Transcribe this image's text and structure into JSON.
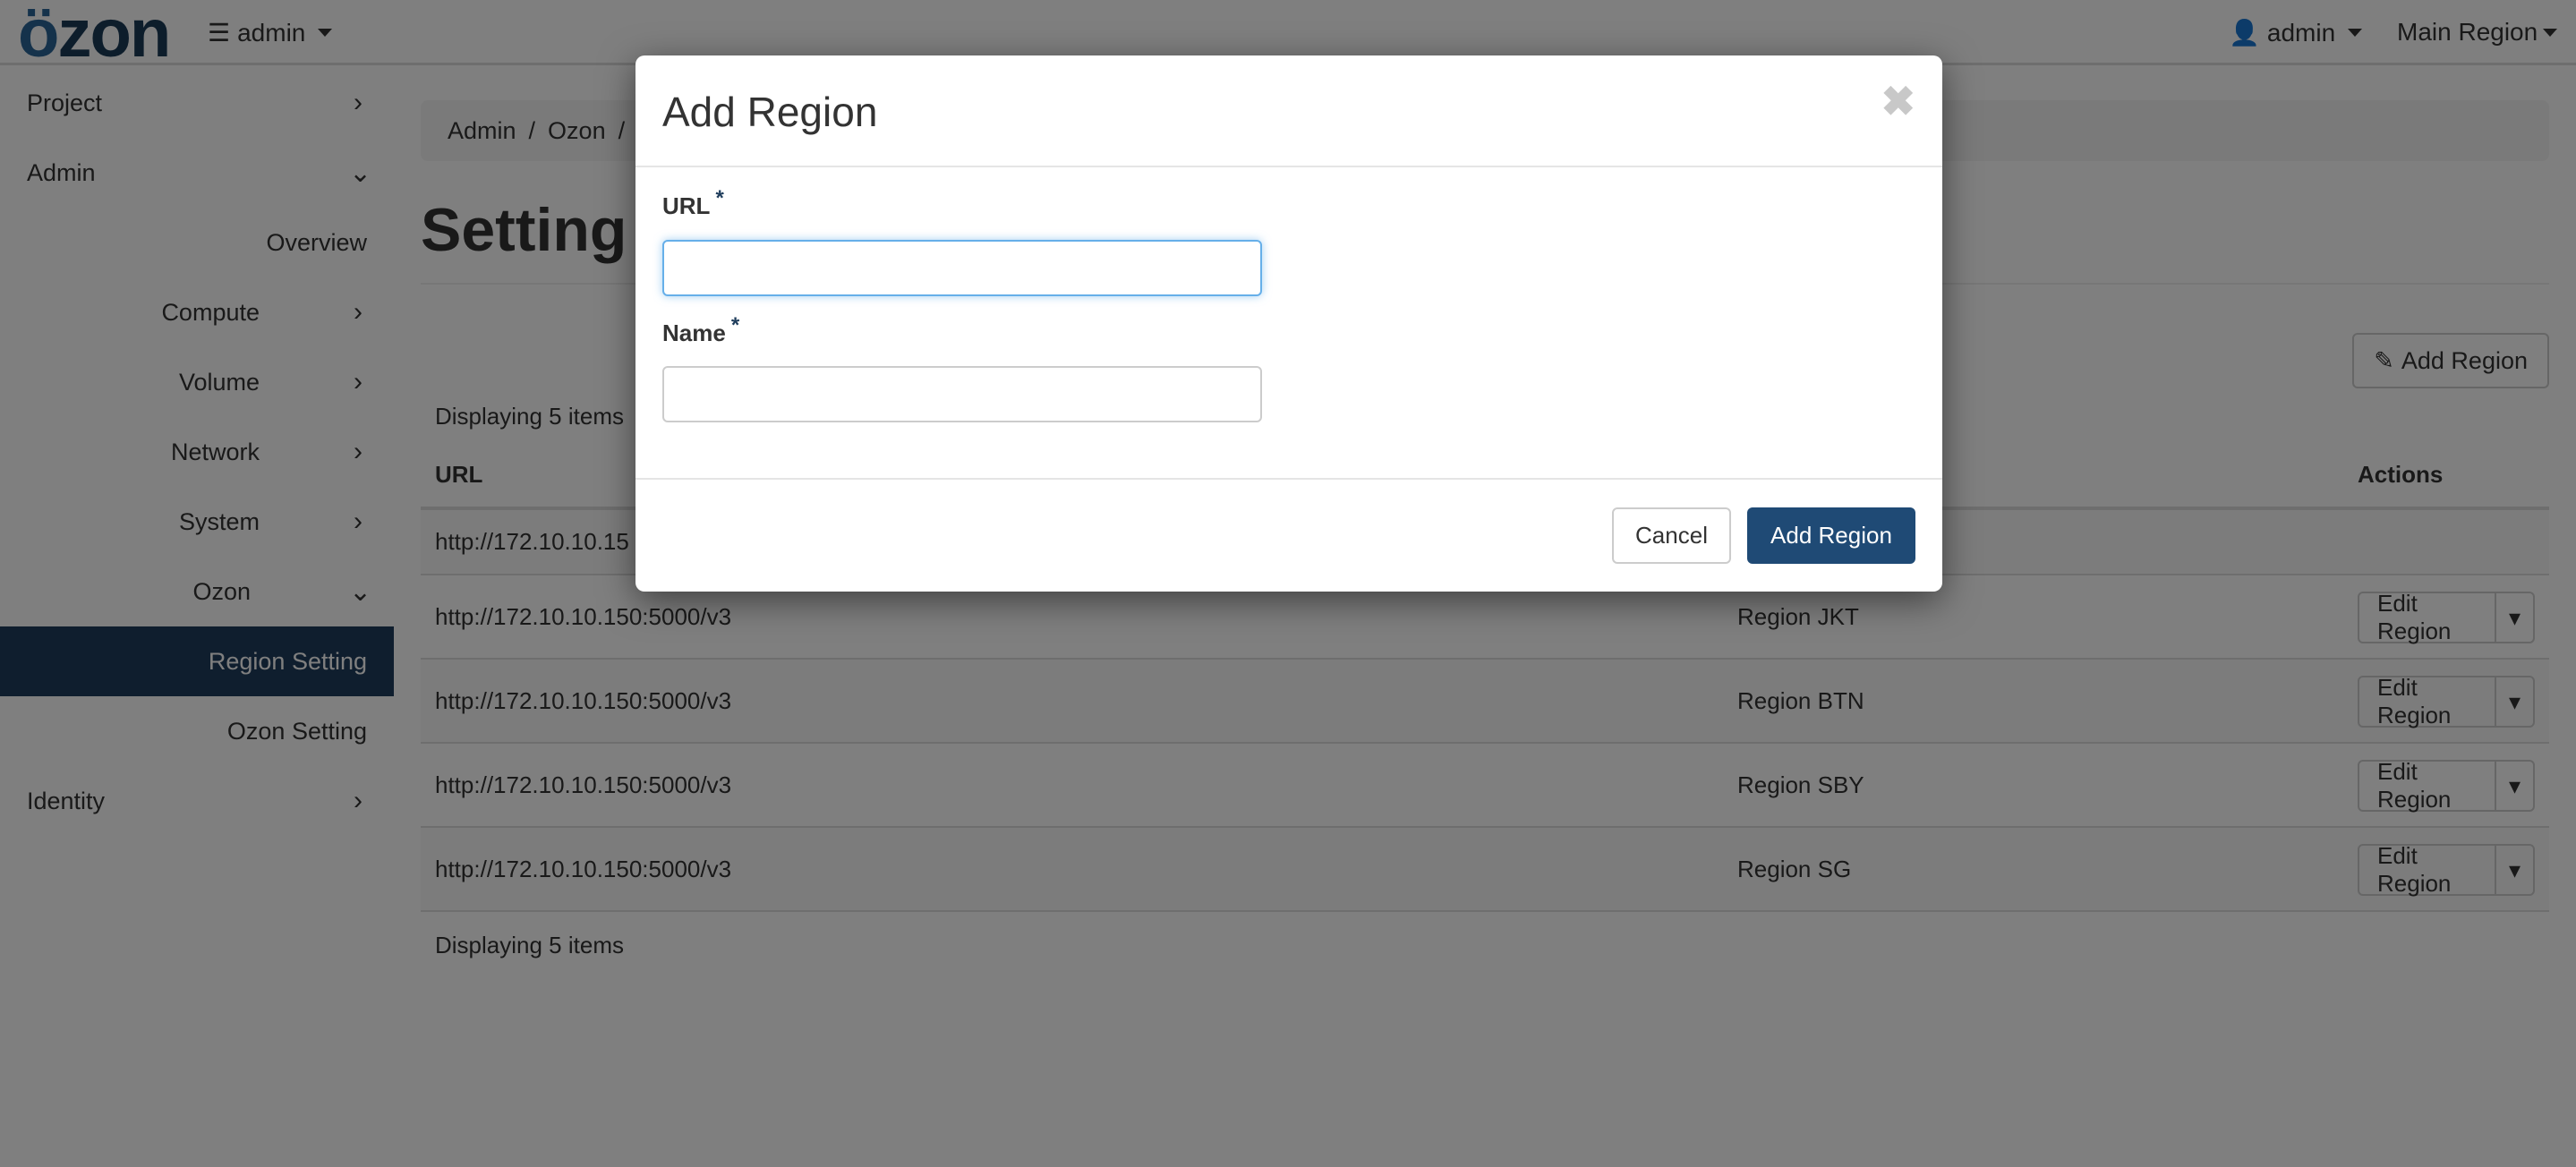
{
  "topbar": {
    "logo": "ozon",
    "project": "admin",
    "user": "admin",
    "region": "Main Region"
  },
  "sidebar": {
    "items": [
      {
        "label": "Project",
        "icon": "chevron-right"
      },
      {
        "label": "Admin",
        "icon": "chevron-down"
      },
      {
        "label": "Overview"
      },
      {
        "label": "Compute",
        "icon": "chevron-right"
      },
      {
        "label": "Volume",
        "icon": "chevron-right"
      },
      {
        "label": "Network",
        "icon": "chevron-right"
      },
      {
        "label": "System",
        "icon": "chevron-right"
      },
      {
        "label": "Ozon",
        "icon": "chevron-down"
      },
      {
        "label": "Region Setting",
        "active": true
      },
      {
        "label": "Ozon Setting"
      },
      {
        "label": "Identity",
        "icon": "chevron-right"
      }
    ]
  },
  "breadcrumb": [
    "Admin",
    "Ozon"
  ],
  "page_title": "Setting",
  "toolbar": {
    "add_label": "Add Region"
  },
  "table": {
    "count": "Displaying 5 items",
    "columns": [
      "URL",
      "",
      "Actions"
    ],
    "rows": [
      {
        "url": "http://172.10.10.15",
        "name": "",
        "action": ""
      },
      {
        "url": "http://172.10.10.150:5000/v3",
        "name": "Region JKT",
        "action": "Edit Region"
      },
      {
        "url": "http://172.10.10.150:5000/v3",
        "name": "Region BTN",
        "action": "Edit Region"
      },
      {
        "url": "http://172.10.10.150:5000/v3",
        "name": "Region SBY",
        "action": "Edit Region"
      },
      {
        "url": "http://172.10.10.150:5000/v3",
        "name": "Region SG",
        "action": "Edit Region"
      }
    ]
  },
  "modal": {
    "title": "Add Region",
    "url_label": "URL",
    "name_label": "Name",
    "required": "*",
    "url_value": "",
    "name_value": "",
    "cancel": "Cancel",
    "submit": "Add Region"
  },
  "colors": {
    "accent": "#1f4a75",
    "active_nav": "#1f3d5c",
    "focus": "#66afe9"
  }
}
